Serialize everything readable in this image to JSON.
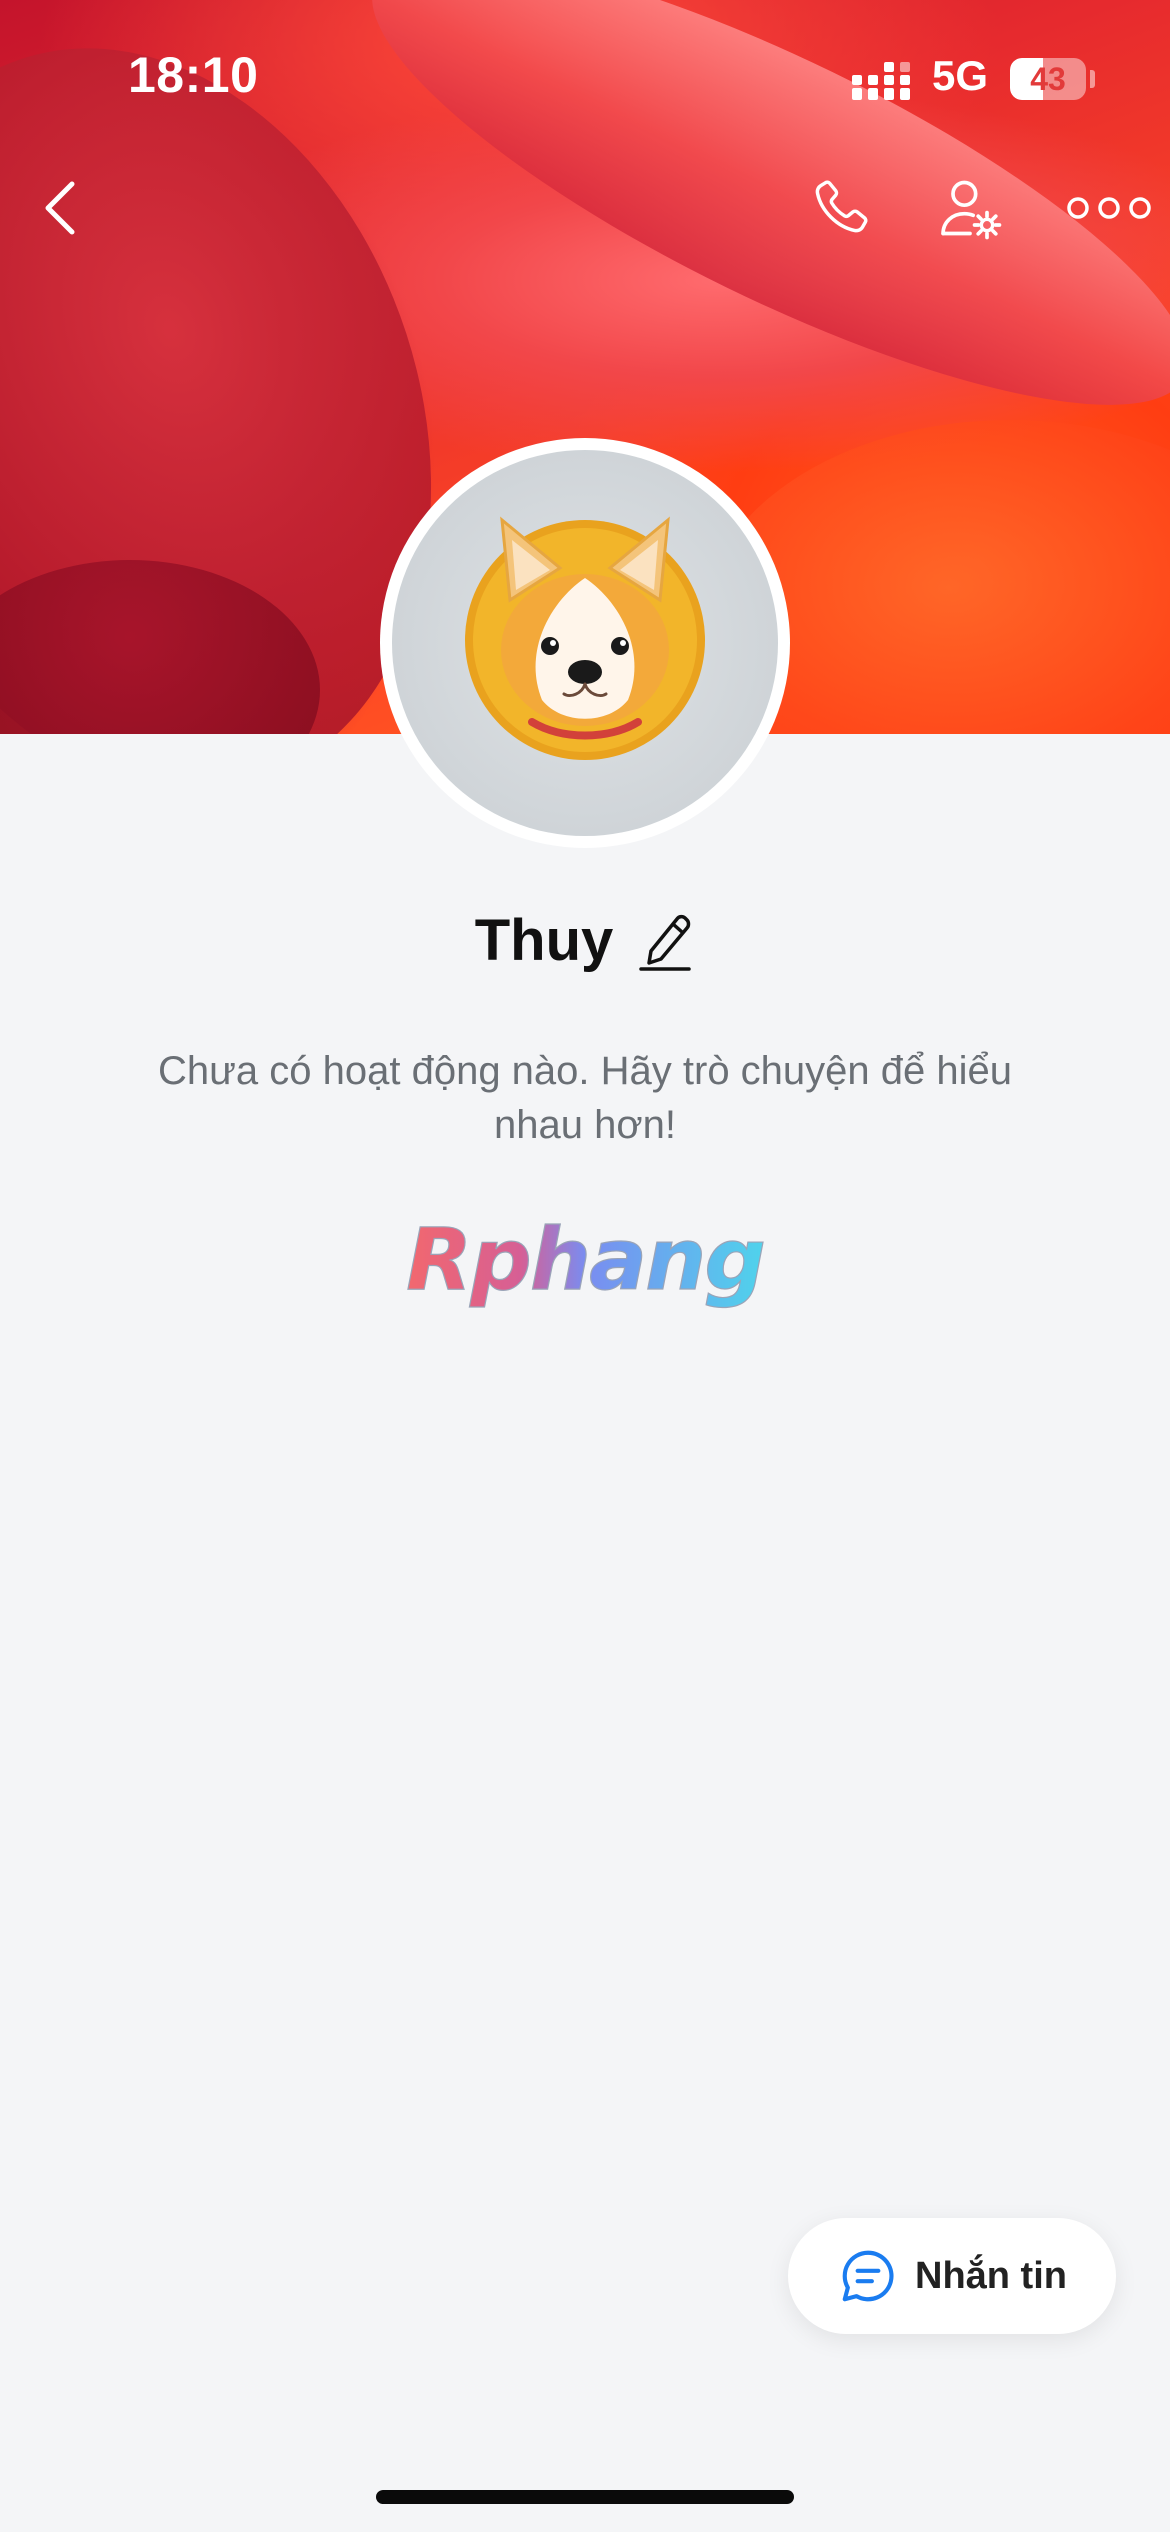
{
  "status_bar": {
    "time": "18:10",
    "network": "5G",
    "battery": "43",
    "battery_level": 0.43
  },
  "nav": {
    "back_icon": "chevron-left-icon",
    "call_icon": "phone-icon",
    "settings_icon": "user-settings-icon",
    "more_icon": "more-horizontal-icon"
  },
  "profile": {
    "name": "Thuy",
    "avatar_icon": "corgi-avatar",
    "edit_icon": "pencil-icon",
    "empty_message": "Chưa có hoạt động nào. Hãy trò chuyện để hiểu nhau hơn!"
  },
  "watermark": {
    "text": "Rphang"
  },
  "message_button": {
    "label": "Nhắn tin",
    "icon": "chat-bubble-icon",
    "icon_color": "#1a7cf0"
  }
}
